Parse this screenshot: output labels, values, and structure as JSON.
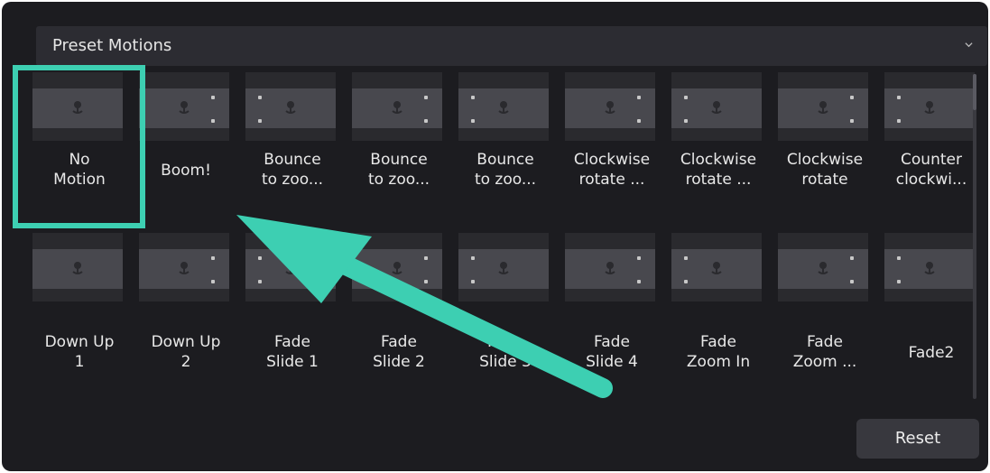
{
  "dropdown": {
    "label": "Preset Motions",
    "icon": "chevron-down-icon"
  },
  "presets_row1": [
    {
      "line1": "No",
      "line2": "Motion"
    },
    {
      "line1": "Boom!",
      "line2": ""
    },
    {
      "line1": "Bounce",
      "line2": "to zoo..."
    },
    {
      "line1": "Bounce",
      "line2": "to zoo..."
    },
    {
      "line1": "Bounce",
      "line2": "to zoo..."
    },
    {
      "line1": "Clockwise",
      "line2": "rotate ..."
    },
    {
      "line1": "Clockwise",
      "line2": "rotate ..."
    },
    {
      "line1": "Clockwise",
      "line2": "rotate"
    },
    {
      "line1": "Counter",
      "line2": "clockwi..."
    }
  ],
  "presets_row2": [
    {
      "line1": "Down Up",
      "line2": "1"
    },
    {
      "line1": "Down Up",
      "line2": "2"
    },
    {
      "line1": "Fade",
      "line2": "Slide 1"
    },
    {
      "line1": "Fade",
      "line2": "Slide 2"
    },
    {
      "line1": "Fade",
      "line2": "Slide 3"
    },
    {
      "line1": "Fade",
      "line2": "Slide 4"
    },
    {
      "line1": "Fade",
      "line2": "Zoom In"
    },
    {
      "line1": "Fade",
      "line2": "Zoom ..."
    },
    {
      "line1": "Fade2",
      "line2": ""
    }
  ],
  "reset_button": {
    "label": "Reset"
  },
  "annotation": {
    "color": "#3dcfb2"
  },
  "colors": {
    "panel": "#1c1c20",
    "accent": "#3dcfb2"
  }
}
